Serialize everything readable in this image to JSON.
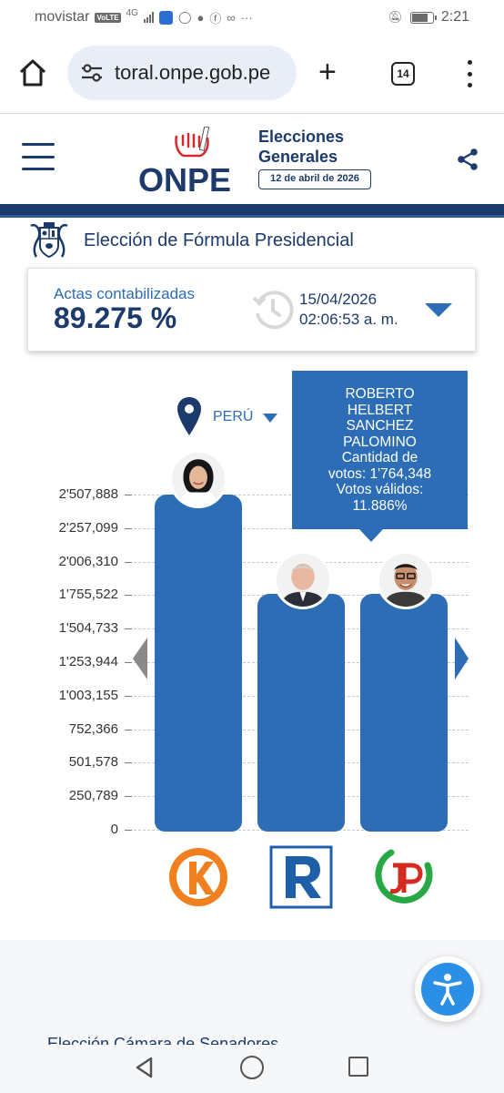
{
  "status_bar": {
    "carrier": "movistar",
    "volte": "VoLTE",
    "network": "4G",
    "time": "2:21"
  },
  "browser": {
    "url": "toral.onpe.gob.pe",
    "tab_count": "14"
  },
  "site": {
    "logo_text": "ONPE",
    "elecciones_line1": "Elecciones",
    "elecciones_line2": "Generales",
    "election_date": "12 de abril de 2026",
    "brand_color": "#1c3a6b",
    "accent_color": "#2c6db5"
  },
  "section": {
    "title": "Elección de Fórmula Presidencial"
  },
  "actas": {
    "label": "Actas contabilizadas",
    "value": "89.275 %",
    "progress_percent": 89.275,
    "date": "15/04/2026",
    "time": "02:06:53 a. m."
  },
  "region": {
    "selected": "PERÚ"
  },
  "tooltip": {
    "line1": "ROBERTO",
    "line2": "HELBERT",
    "line3": "SANCHEZ",
    "line4": "PALOMINO",
    "line5": "Cantidad de",
    "line6": "votos: 1'764,348",
    "line7": "Votos válidos:",
    "line8": "11.886%"
  },
  "chart_data": {
    "type": "bar",
    "categories": [
      "K",
      "R",
      "JP"
    ],
    "values": [
      2507888,
      1764348,
      1764348
    ],
    "ylim": [
      0,
      2507888
    ],
    "y_ticks": [
      "2'507,888",
      "2'257,099",
      "2'006,310",
      "1'755,522",
      "1'504,733",
      "1'253,944",
      "1'003,155",
      "752,366",
      "501,578",
      "250,789",
      "0"
    ],
    "y_tick_values": [
      2507888,
      2257099,
      2006310,
      1755522,
      1504733,
      1253944,
      1003155,
      752366,
      501578,
      250789,
      0
    ],
    "grid": true,
    "bar_color": "#2c6db5"
  },
  "footer": {
    "next_section": "Elección Cámara de Senadores"
  }
}
